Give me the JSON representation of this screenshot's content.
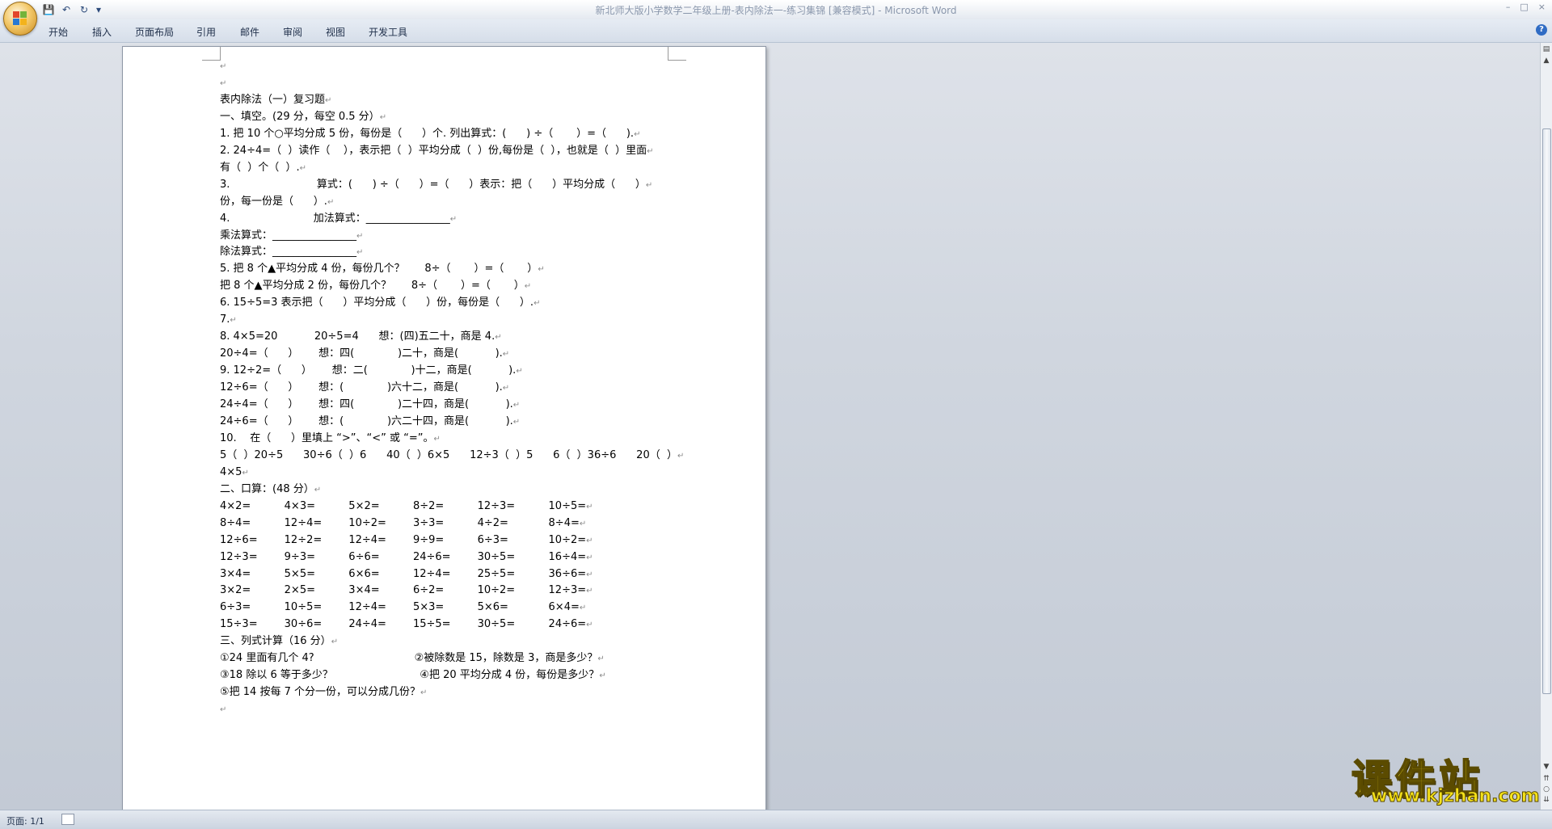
{
  "window": {
    "title": "新北师大版小学数学二年级上册-表内除法一-练习集锦 [兼容模式] - Microsoft Word",
    "controls": [
      "–",
      "□",
      "×"
    ]
  },
  "quick_access": {
    "save_icon": "save-icon",
    "undo_icon": "undo-icon",
    "redo_icon": "redo-icon"
  },
  "ribbon": {
    "tabs": [
      "开始",
      "插入",
      "页面布局",
      "引用",
      "邮件",
      "审阅",
      "视图",
      "开发工具"
    ]
  },
  "document": {
    "paragraph_mark": "↵",
    "lines": [
      "",
      "",
      "表内除法（一）复习题",
      "一、填空。(29 分，每空 0.5 分）",
      "1. 把 10 个○平均分成 5 份，每份是（      ）个. 列出算式：(      ) ÷（       ）=（      ).",
      "2. 24÷4=（  ）读作（    ），表示把（  ）平均分成（  ）份,每份是（  ），也就是（  ）里面",
      "有（  ）个（  ）.",
      "3.                          算式：(      ) ÷（      ）=（      ）表示：把（      ）平均分成（      ）",
      "份，每一份是（      ）.",
      "4.                         加法算式：________________",
      "乘法算式：________________",
      "除法算式：________________",
      "5. 把 8 个▲平均分成 4 份，每份几个？      8÷（       ）=（       ）",
      "把 8 个▲平均分成 2 份，每份几个？      8÷（       ）=（       ）",
      "6. 15÷5=3 表示把（      ）平均分成（      ）份，每份是（      ）.",
      "7.",
      "8. 4×5=20           20÷5=4      想：(四)五二十，商是 4.",
      "20÷4=（      ）      想：四(             )二十，商是(           ).",
      "9. 12÷2=（      ）      想：二(             )十二，商是(           ).",
      "12÷6=（      ）      想：(             )六十二，商是(           ).",
      "24÷4=（      ）      想：四(             )二十四，商是(           ).",
      "24÷6=（      ）      想：(             )六二十四，商是(           ).",
      "10.    在（      ）里填上 “>”、“<” 或 “=”。",
      "5（  ）20÷5      30÷6（  ）6      40（  ）6×5      12÷3（  ）5      6（  ）36÷6      20（  ）",
      "4×5",
      "二、口算：(48 分）",
      "4×2=          4×3=          5×2=          8÷2=          12÷3=          10÷5=",
      "8÷4=          12÷4=        10÷2=        3÷3=          4÷2=            8÷4=",
      "12÷6=        12÷2=        12÷4=        9÷9=          6÷3=            10÷2=",
      "12÷3=        9÷3=          6÷6=          24÷6=        30÷5=          16÷4=",
      "3×4=          5×5=          6×6=          12÷4=        25÷5=          36÷6=",
      "3×2=          2×5=          3×4=          6÷2=          10÷2=          12÷3=",
      "6÷3=          10÷5=        12÷4=        5×3=          5×6=            6×4=",
      "15÷3=        30÷6=        24÷4=        15÷5=        30÷5=          24÷6=",
      "三、列式计算（16 分）",
      "①24 里面有几个 4?                              ②被除数是 15，除数是 3，商是多少？",
      "③18 除以 6 等于多少？                          ④把 20 平均分成 4 份，每份是多少？",
      "⑤把 14 按每 7 个分一份，可以分成几份？",
      ""
    ]
  },
  "status": {
    "page": "页面: 1/1"
  },
  "watermark": {
    "text": "课件站",
    "url": "www.kjzhan.com"
  }
}
